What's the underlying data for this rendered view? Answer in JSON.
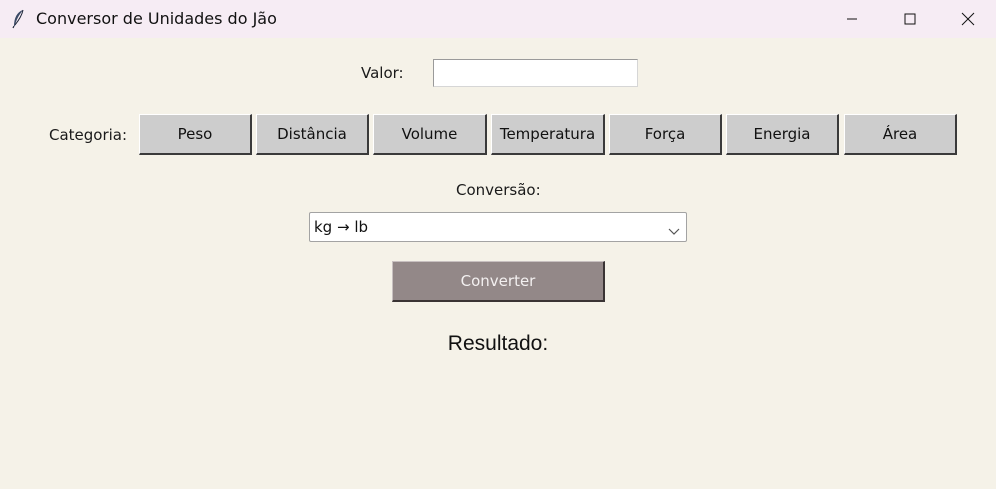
{
  "window": {
    "title": "Conversor de Unidades do Jão",
    "icon": "feather-icon",
    "controls": [
      "minimize-icon",
      "maximize-icon",
      "close-icon"
    ]
  },
  "form": {
    "valor_label": "Valor:",
    "valor_value": "",
    "categoria_label": "Categoria:",
    "categories": [
      "Peso",
      "Distância",
      "Volume",
      "Temperatura",
      "Força",
      "Energia",
      "Área"
    ],
    "conversao_label": "Conversão:",
    "conversao_selected": "kg → lb",
    "convert_label": "Converter",
    "resultado_label": "Resultado:"
  },
  "colors": {
    "background": "#f5f2e8",
    "titlebar": "#f6ecf4",
    "category_button": "#cdcdcd",
    "convert_button": "#938888",
    "convert_text": "#f3f0f0"
  }
}
